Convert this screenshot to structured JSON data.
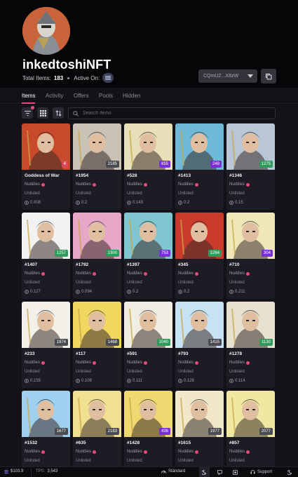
{
  "profile": {
    "name": "inkedtoshiNFT",
    "total_items_label": "Total Items:",
    "total_items": "183",
    "active_on_label": "Active On:",
    "wallet": "CQmUZ...X8zW"
  },
  "tabs": [
    "Items",
    "Activity",
    "Offers",
    "Pools",
    "Hidden"
  ],
  "active_tab": "Items",
  "search": {
    "placeholder": "Search items"
  },
  "items": [
    {
      "title": "Goddess of War",
      "collection": "Nuddies",
      "listing": "Unlisted",
      "price": "0.008",
      "rank": "4",
      "rank_color": "#d94a5a",
      "art": "#c94a2a"
    },
    {
      "title": "#1954",
      "collection": "Nuddies",
      "listing": "Unlisted",
      "price": "0.2",
      "rank": "2185",
      "rank_color": "#4a4a52",
      "art": "#c9c2b5"
    },
    {
      "title": "#528",
      "collection": "Nuddies",
      "listing": "Unlisted",
      "price": "0.143",
      "rank": "655",
      "rank_color": "#7a2fd6",
      "art": "#e7dfb8"
    },
    {
      "title": "#1413",
      "collection": "Nuddies",
      "listing": "Unlisted",
      "price": "0.2",
      "rank": "248",
      "rank_color": "#7a2fd6",
      "art": "#6fb8d6"
    },
    {
      "title": "#1346",
      "collection": "Nuddies",
      "listing": "Unlisted",
      "price": "0.15",
      "rank": "1275",
      "rank_color": "#2f9a5a",
      "art": "#b9c6d6"
    },
    {
      "title": "#1407",
      "collection": "Nuddies",
      "listing": "Unlisted",
      "price": "0.127",
      "rank": "1257",
      "rank_color": "#2f9a5a",
      "art": "#f2f2f2"
    },
    {
      "title": "#1792",
      "collection": "Nuddies",
      "listing": "Unlisted",
      "price": "0.094",
      "rank": "1300",
      "rank_color": "#2f9a5a",
      "art": "#e7a7c8"
    },
    {
      "title": "#1397",
      "collection": "Nuddies",
      "listing": "Unlisted",
      "price": "0.2",
      "rank": "753",
      "rank_color": "#7a2fd6",
      "art": "#7fc6d0"
    },
    {
      "title": "#345",
      "collection": "Nuddies",
      "listing": "Unlisted",
      "price": "0.2",
      "rank": "1264",
      "rank_color": "#2f9a5a",
      "art": "#c93a2a"
    },
    {
      "title": "#710",
      "collection": "Nuddies",
      "listing": "Unlisted",
      "price": "0.211",
      "rank": "304",
      "rank_color": "#7a2fd6",
      "art": "#f0e7b8"
    },
    {
      "title": "#233",
      "collection": "Nuddies",
      "listing": "Unlisted",
      "price": "0.155",
      "rank": "1974",
      "rank_color": "#4a4a52",
      "art": "#f2f0e8"
    },
    {
      "title": "#117",
      "collection": "Nuddies",
      "listing": "Unlisted",
      "price": "0.109",
      "rank": "1468",
      "rank_color": "#4a4a52",
      "art": "#f0d860"
    },
    {
      "title": "#591",
      "collection": "Nuddies",
      "listing": "Unlisted",
      "price": "0.111",
      "rank": "1040",
      "rank_color": "#2f9a5a",
      "art": "#f0ede2"
    },
    {
      "title": "#793",
      "collection": "Nuddies",
      "listing": "Unlisted",
      "price": "0.126",
      "rank": "1415",
      "rank_color": "#4a4a52",
      "art": "#c7e2f2"
    },
    {
      "title": "#1278",
      "collection": "Nuddies",
      "listing": "Unlisted",
      "price": "0.114",
      "rank": "1130",
      "rank_color": "#2f9a5a",
      "art": "#e8e0d0"
    },
    {
      "title": "#1532",
      "collection": "Nuddies",
      "listing": "Unlisted",
      "price": "",
      "rank": "1677",
      "rank_color": "#4a4a52",
      "art": "#9fd0f0"
    },
    {
      "title": "#635",
      "collection": "Nuddies",
      "listing": "Unlisted",
      "price": "",
      "rank": "2183",
      "rank_color": "#4a4a52",
      "art": "#f0e090"
    },
    {
      "title": "#1428",
      "collection": "Nuddies",
      "listing": "Unlisted",
      "price": "",
      "rank": "436",
      "rank_color": "#7a2fd6",
      "art": "#f0d870"
    },
    {
      "title": "#1615",
      "collection": "Nuddies",
      "listing": "Unlisted",
      "price": "",
      "rank": "1977",
      "rank_color": "#4a4a52",
      "art": "#f0e8c8"
    },
    {
      "title": "#857",
      "collection": "Nuddies",
      "listing": "Unlisted",
      "price": "",
      "rank": "2077",
      "rank_color": "#4a4a52",
      "art": "#f0e8a0"
    }
  ],
  "footer": {
    "price": "$103.9",
    "tps_label": "TPS:",
    "tps": "3,543",
    "mode": "Standard",
    "support": "Support"
  },
  "colors": {
    "accent": "#e54a7b",
    "background": "#131219",
    "card": "#1d1c25"
  }
}
